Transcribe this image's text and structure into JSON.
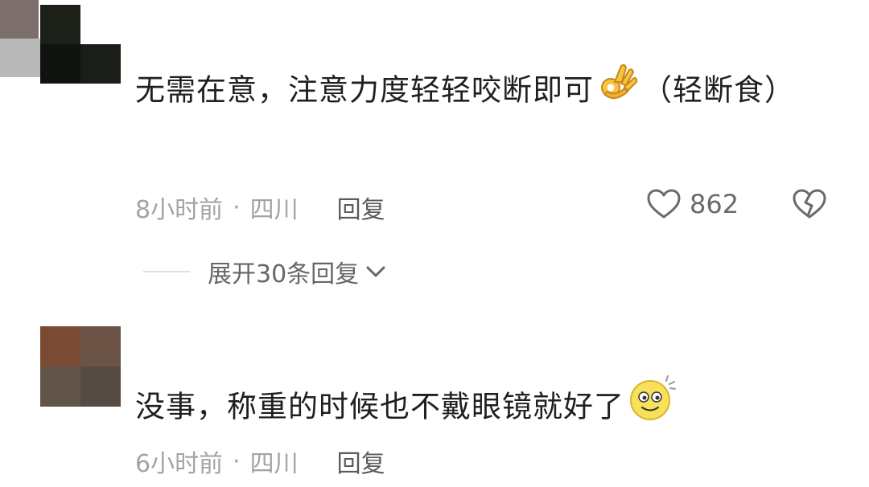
{
  "comments": [
    {
      "text_before_emoji": "无需在意，注意力度轻轻咬断即可",
      "emoji_icon": "ok-hand-icon",
      "text_after_emoji": "（轻断食）",
      "time": "8小时前",
      "separator": "·",
      "location": "四川",
      "reply_label": "回复",
      "like_count": "862",
      "replies_toggle": "展开30条回复"
    },
    {
      "text": "没事，称重的时候也不戴眼镜就好了",
      "emoji_icon": "dizzy-smile-icon",
      "time": "6小时前",
      "separator": "·",
      "location": "四川",
      "reply_label": "回复"
    }
  ],
  "colors": {
    "text_primary": "#202020",
    "text_meta": "#a3a3a3",
    "text_secondary": "#666666"
  }
}
